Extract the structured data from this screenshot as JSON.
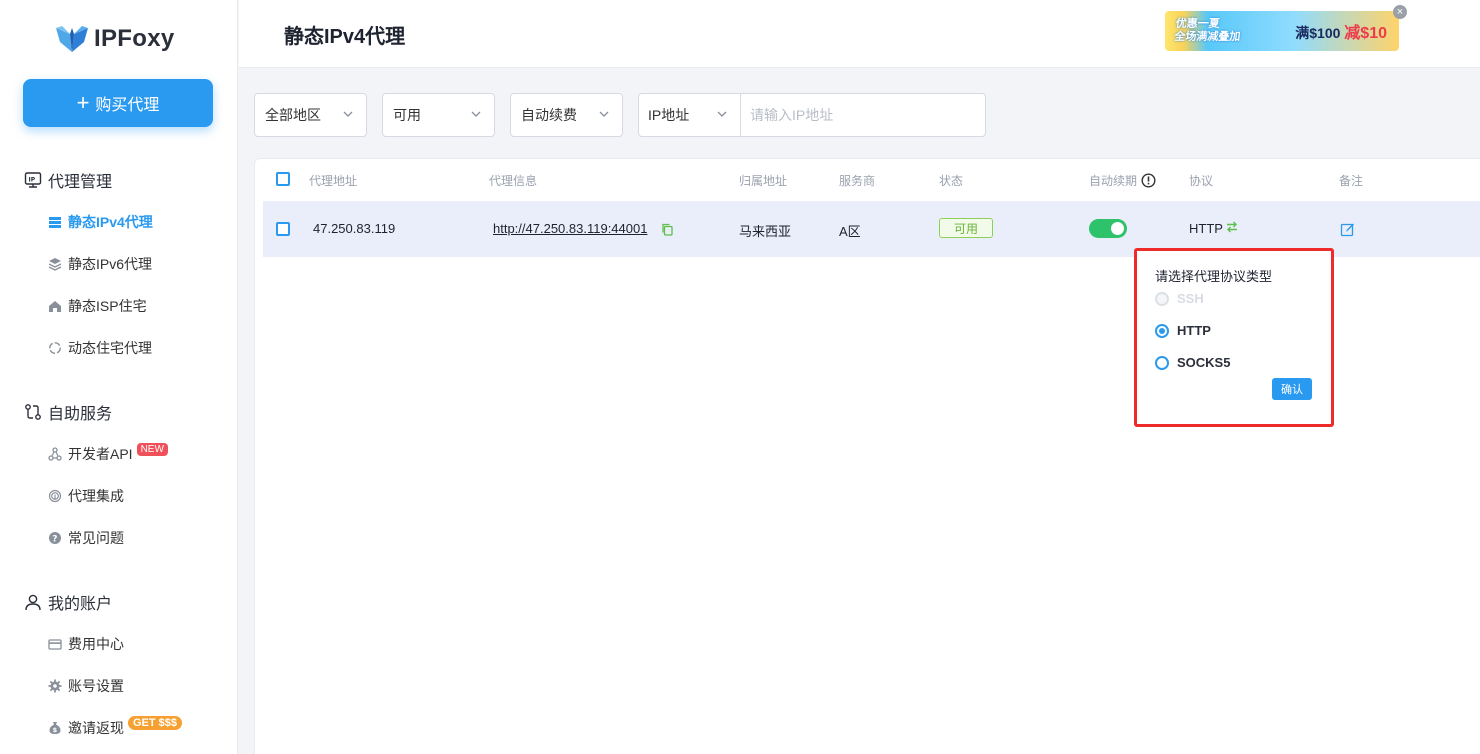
{
  "brand": {
    "name": "IPFoxy"
  },
  "sidebar": {
    "buy_button": "购买代理",
    "groups": [
      {
        "title": "代理管理",
        "items": [
          {
            "label": "静态IPv4代理"
          },
          {
            "label": "静态IPv6代理"
          },
          {
            "label": "静态ISP住宅"
          },
          {
            "label": "动态住宅代理"
          }
        ]
      },
      {
        "title": "自助服务",
        "items": [
          {
            "label": "开发者API",
            "badge": "NEW"
          },
          {
            "label": "代理集成"
          },
          {
            "label": "常见问题"
          }
        ]
      },
      {
        "title": "我的账户",
        "items": [
          {
            "label": "费用中心"
          },
          {
            "label": "账号设置"
          },
          {
            "label": "邀请返现",
            "badge": "GET $$$"
          }
        ]
      }
    ]
  },
  "header": {
    "title": "静态IPv4代理",
    "promo": {
      "left_line1": "优惠一夏",
      "left_line2": "全场满减叠加",
      "right_a": "满$100",
      "right_b": "减$10",
      "close": "×"
    }
  },
  "filters": {
    "region": "全部地区",
    "status": "可用",
    "renew": "自动续费",
    "ip_type": "IP地址",
    "ip_placeholder": "请输入IP地址"
  },
  "table": {
    "columns": [
      "代理地址",
      "代理信息",
      "归属地址",
      "服务商",
      "状态",
      "自动续期",
      "协议",
      "备注"
    ],
    "rows": [
      {
        "address": "47.250.83.119",
        "info": "http://47.250.83.119:44001",
        "location": "马来西亚",
        "provider": "A区",
        "status": "可用",
        "auto_renew": true,
        "protocol": "HTTP"
      }
    ]
  },
  "popover": {
    "title": "请选择代理协议类型",
    "options": [
      {
        "label": "SSH",
        "state": "disabled"
      },
      {
        "label": "HTTP",
        "state": "checked"
      },
      {
        "label": "SOCKS5",
        "state": "unchecked"
      }
    ],
    "confirm": "确认"
  },
  "colors": {
    "accent": "#2a9af0",
    "success": "#2ec26a",
    "highlight_border": "#ee2a2a"
  }
}
